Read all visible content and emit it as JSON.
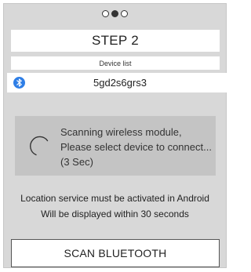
{
  "progress": {
    "total_steps": 3,
    "current_step": 2
  },
  "step": {
    "title": "STEP 2"
  },
  "device_list": {
    "header": "Device list",
    "devices": [
      {
        "name": "5gd2s6grs3",
        "icon": "bluetooth-icon"
      }
    ]
  },
  "scanning": {
    "line1": "Scanning wireless module,",
    "line2": "Please select device to connect...",
    "line3": "(3 Sec)",
    "icon": "spinner-icon"
  },
  "info": {
    "line1": "Location service must be activated in Android",
    "line2": "Will be displayed within 30 seconds"
  },
  "actions": {
    "scan_label": "SCAN BLUETOOTH"
  },
  "colors": {
    "background": "#d8d8d8",
    "bluetooth_accent": "#2e7ee6",
    "panel": "#c4c4c4"
  }
}
